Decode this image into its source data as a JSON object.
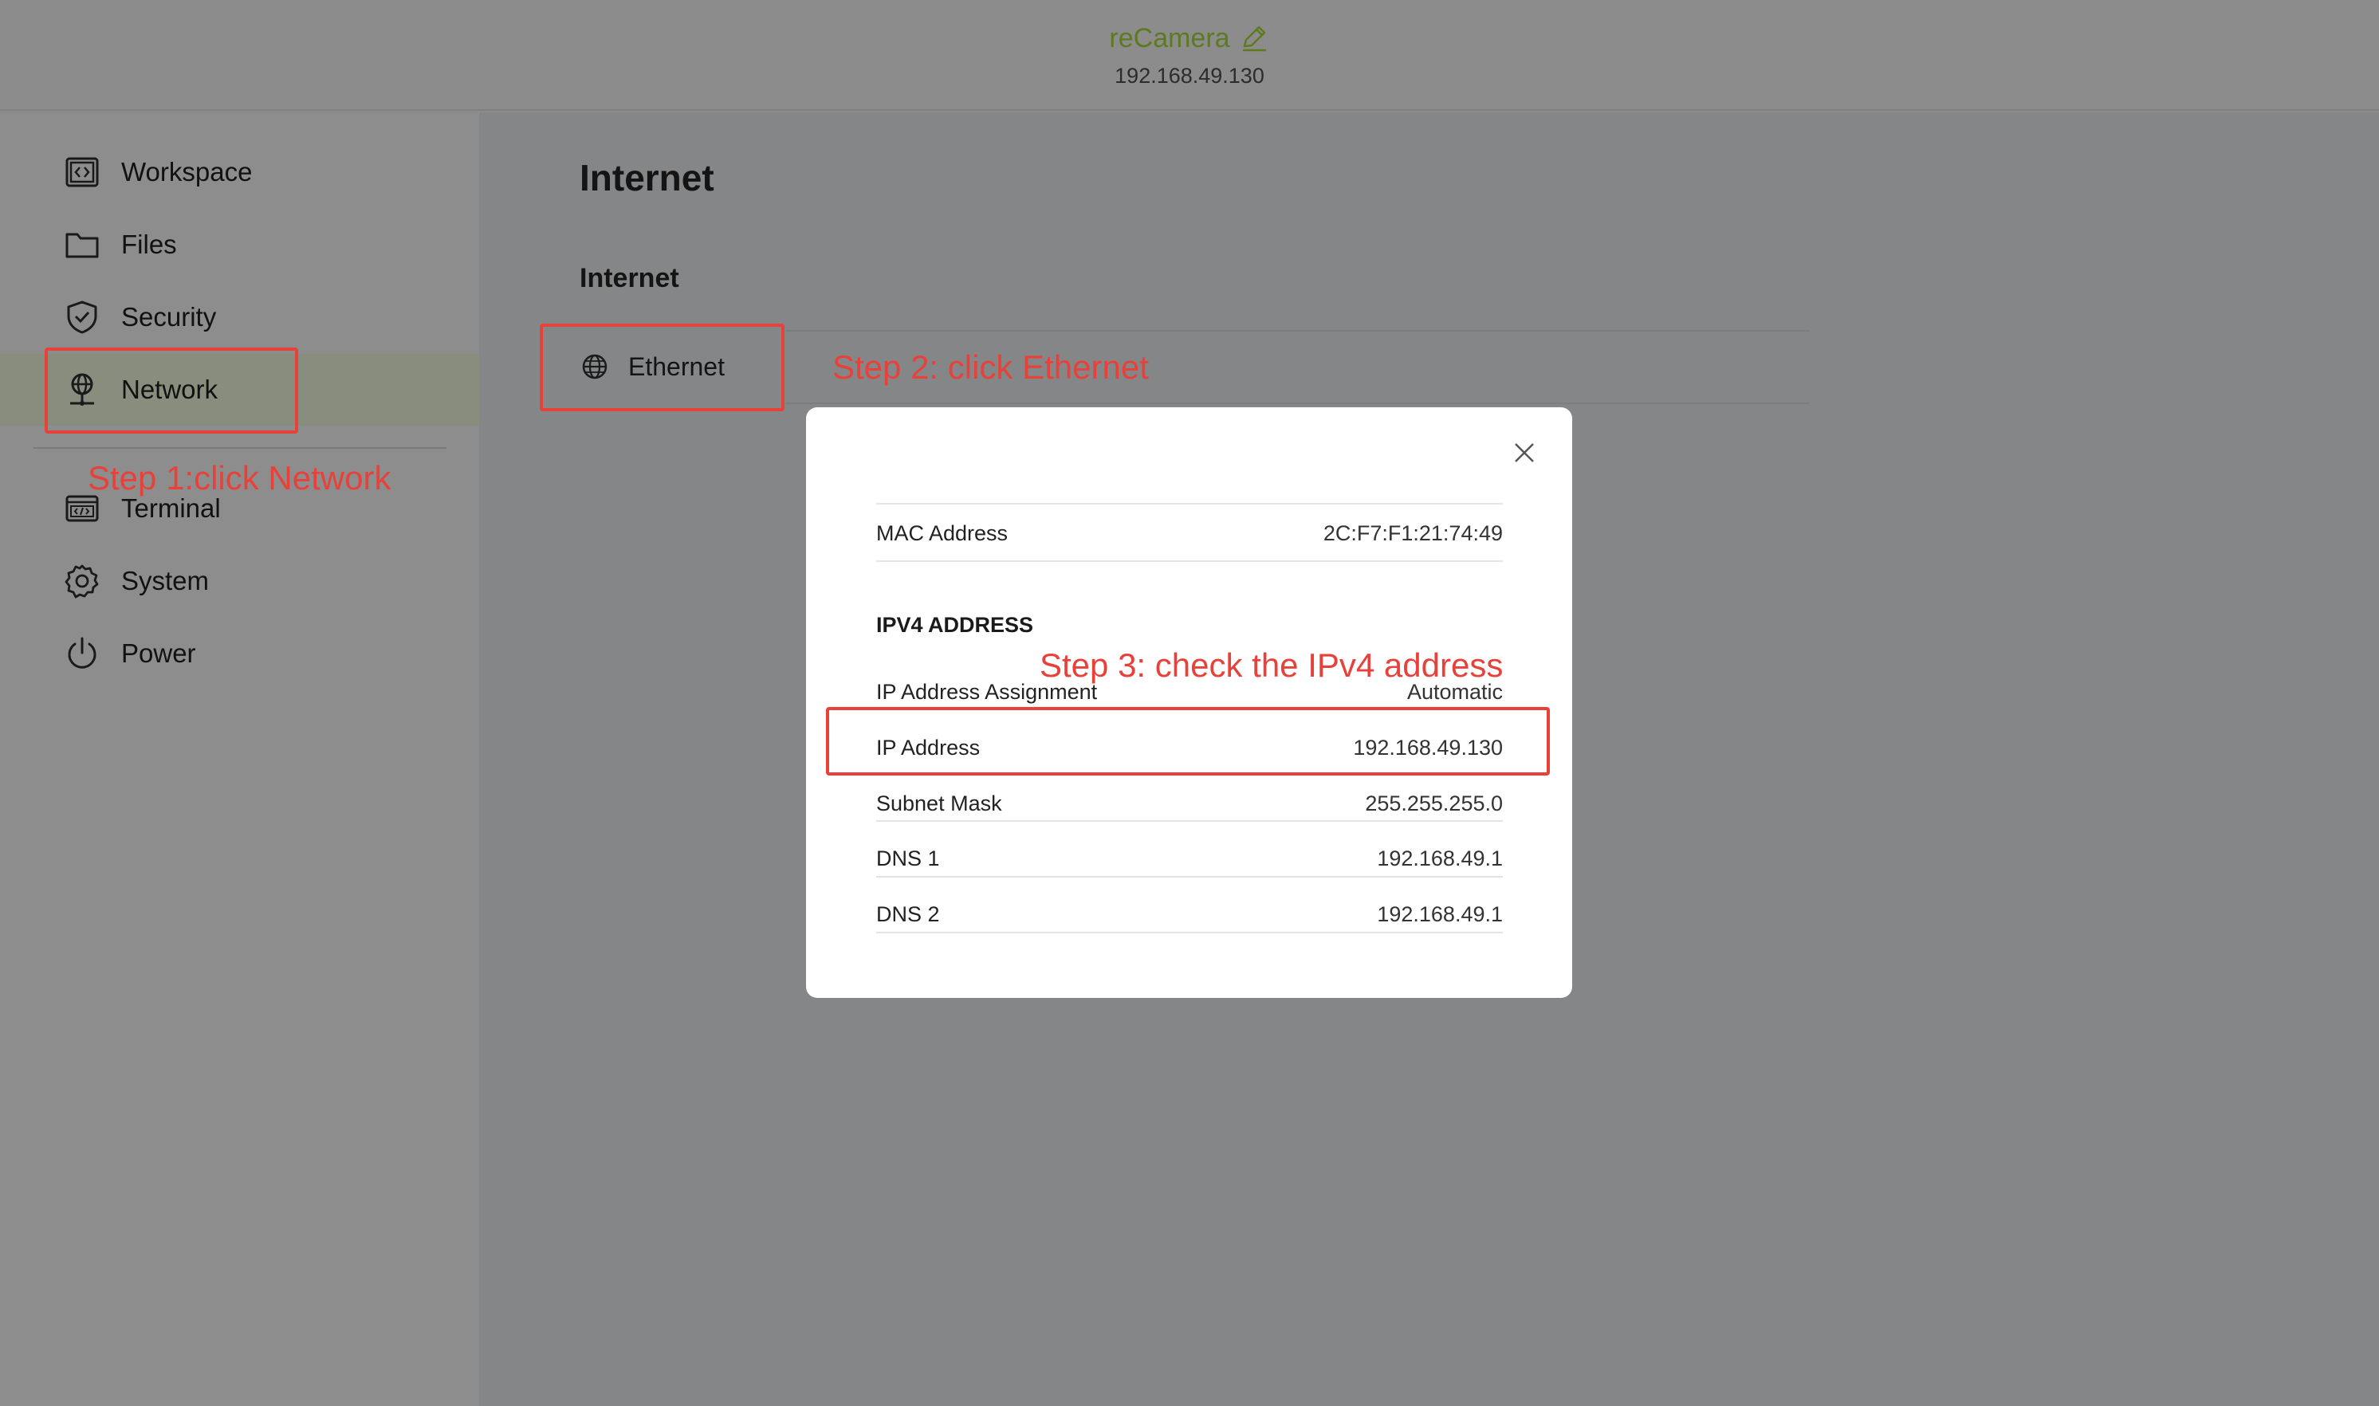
{
  "header": {
    "device_name": "reCamera",
    "device_ip": "192.168.49.130"
  },
  "sidebar": {
    "items": [
      {
        "label": "Workspace",
        "icon": "code-window-icon"
      },
      {
        "label": "Files",
        "icon": "folder-icon"
      },
      {
        "label": "Security",
        "icon": "shield-icon"
      },
      {
        "label": "Network",
        "icon": "network-globe-icon",
        "active": true
      },
      {
        "label": "Terminal",
        "icon": "terminal-icon"
      },
      {
        "label": "System",
        "icon": "gear-icon"
      },
      {
        "label": "Power",
        "icon": "power-icon"
      }
    ]
  },
  "main": {
    "page_title": "Internet",
    "section_title": "Internet",
    "connections": [
      {
        "label": "Ethernet",
        "icon": "globe-icon"
      }
    ]
  },
  "modal": {
    "mac_label": "MAC Address",
    "mac_value": "2C:F7:F1:21:74:49",
    "ipv4_heading": "IPV4 ADDRESS",
    "rows": [
      {
        "label": "IP Address Assignment",
        "value": "Automatic"
      },
      {
        "label": "IP Address",
        "value": "192.168.49.130"
      },
      {
        "label": "Subnet Mask",
        "value": "255.255.255.0"
      },
      {
        "label": "DNS 1",
        "value": "192.168.49.1"
      },
      {
        "label": "DNS 2",
        "value": "192.168.49.1"
      }
    ]
  },
  "annotations": {
    "step1": "Step 1:click Network",
    "step2": "Step 2: click Ethernet",
    "step3": "Step 3: check the IPv4 address"
  },
  "colors": {
    "accent_green": "#5d7a1f",
    "annotation_red": "#e8413a",
    "overlay_gray": "#8a8b8b"
  }
}
